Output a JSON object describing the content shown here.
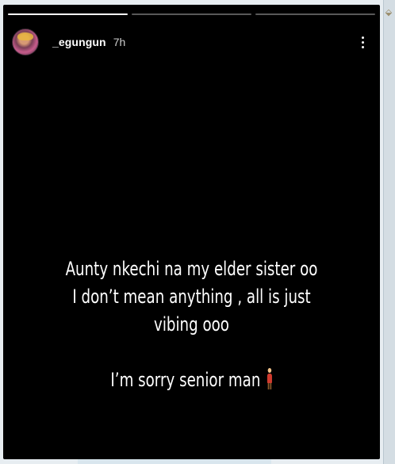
{
  "story": {
    "progress": [
      1,
      0,
      0
    ],
    "user": {
      "username": "_egungun",
      "time": "7h"
    },
    "caption": {
      "line1": "Aunty nkechi na my elder sister oo",
      "line2": "I don’t mean anything , all is just",
      "line3": "vibing ooo",
      "line4": "I’m sorry senior man"
    },
    "icons": {
      "menu": "more-vertical-icon",
      "emoji": "person-standing-emoji"
    }
  },
  "window": {
    "corner_icon": "⬙"
  }
}
